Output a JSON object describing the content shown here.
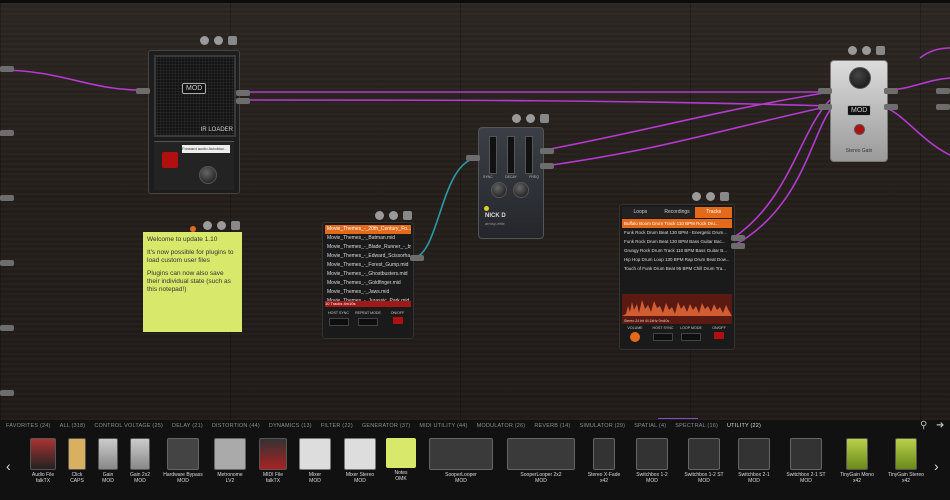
{
  "board": {
    "ir_loader": {
      "badge": "MOD",
      "label": "IR LOADER",
      "file": "Forward audio Autobloc..."
    },
    "notepad": {
      "lines": [
        "Welcome to update 1.10",
        "It's now possible for plugins to load custom user files",
        "Plugins can now also save their individual state (such as this notepad!)"
      ]
    },
    "midi_file": {
      "files": [
        "Movie_Themes_-_20th_Century_Fo...",
        "Movie_Themes_-_Batman.mid",
        "Movie_Themes_-_Blade_Runner_-_by...",
        "Movie_Themes_-_Edward_Scissorha...",
        "Movie_Themes_-_Forest_Gump.mid",
        "Movie_Themes_-_Ghostbusters.mid",
        "Movie_Themes_-_Goldfinger.mid",
        "Movie_Themes_-_Jaws.mid",
        "Movie_Themes_-_Jurassic_Park.mid"
      ],
      "status": "10 Tracks 4m10s",
      "controls": [
        "HOST SYNC",
        "REPEAT MODE",
        "ON/OFF"
      ]
    },
    "nick_d": {
      "title": "NICK D",
      "subtitle": "armsy-ettle",
      "labels": [
        "SYNC",
        "DECAY",
        "FREQ"
      ]
    },
    "sequencer": {
      "tabs": [
        "Loops",
        "Recordings",
        "Tracks"
      ],
      "tracks": [
        "Buffalo Boom Drum Track 110 BPM Rock Dru...",
        "Funk Rock Drum Beat 130 BPM - Energetic Drum...",
        "Funk Rock Drum Beat 130 BPM Bass Guitar Bac...",
        "Grungy Rock Drum Track 110 BPM Bass Guitar B...",
        "Hip Hop Drum Loop 130 BPM Rap Drum Beat Dow...",
        "Touch of Funk Drum Beat 95 BPM Chill Drum Tra..."
      ],
      "wave_caption": "Stereo 24 bit 44.1kHz 0m40s",
      "controls": [
        "VOLUME",
        "HOST SYNC",
        "LOOP MODE",
        "ON/OFF"
      ]
    },
    "stereo_gain": {
      "badge": "MOD",
      "label": "Stereo Gain"
    }
  },
  "library": {
    "categories": [
      "FAVORITES (24)",
      "ALL (318)",
      "CONTROL VOLTAGE (25)",
      "DELAY (21)",
      "DISTORTION (44)",
      "DYNAMICS (13)",
      "FILTER (22)",
      "GENERATOR (37)",
      "MIDI UTILITY (44)",
      "MODULATOR (26)",
      "REVERB (14)",
      "SIMULATOR (29)",
      "SPATIAL (4)",
      "SPECTRAL (16)",
      "UTILITY (22)"
    ],
    "active_category": "UTILITY (22)",
    "plugins": [
      {
        "name": "Audio File",
        "brand": "falkTX"
      },
      {
        "name": "Click",
        "brand": "CAPS"
      },
      {
        "name": "Gain",
        "brand": "MOD"
      },
      {
        "name": "Gain 2x2",
        "brand": "MOD"
      },
      {
        "name": "Hardware Bypass",
        "brand": "MOD"
      },
      {
        "name": "Metronome",
        "brand": "LV2"
      },
      {
        "name": "MIDI File",
        "brand": "falkTX"
      },
      {
        "name": "Mixer",
        "brand": "MOD"
      },
      {
        "name": "Mixer Stereo",
        "brand": "MOD"
      },
      {
        "name": "Notes",
        "brand": "OMK"
      },
      {
        "name": "SooperLooper",
        "brand": "MOD"
      },
      {
        "name": "SooperLooper 2x2",
        "brand": "MOD"
      },
      {
        "name": "Stereo X-Fade",
        "brand": "x42"
      },
      {
        "name": "Switchbox 1-2",
        "brand": "MOD"
      },
      {
        "name": "Switchbox 1-2 ST",
        "brand": "MOD"
      },
      {
        "name": "Switchbox 2-1",
        "brand": "MOD"
      },
      {
        "name": "Switchbox 2-1 ST",
        "brand": "MOD"
      },
      {
        "name": "TinyGain Mono",
        "brand": "x42"
      },
      {
        "name": "TinyGain Stereo",
        "brand": "x42"
      }
    ]
  },
  "colors": {
    "cable": "#b43ad0",
    "cable_teal": "#2a9aa8",
    "accent": "#e36a1a",
    "notepad": "#d8e86a",
    "tab_underline": "#7a54c4"
  }
}
